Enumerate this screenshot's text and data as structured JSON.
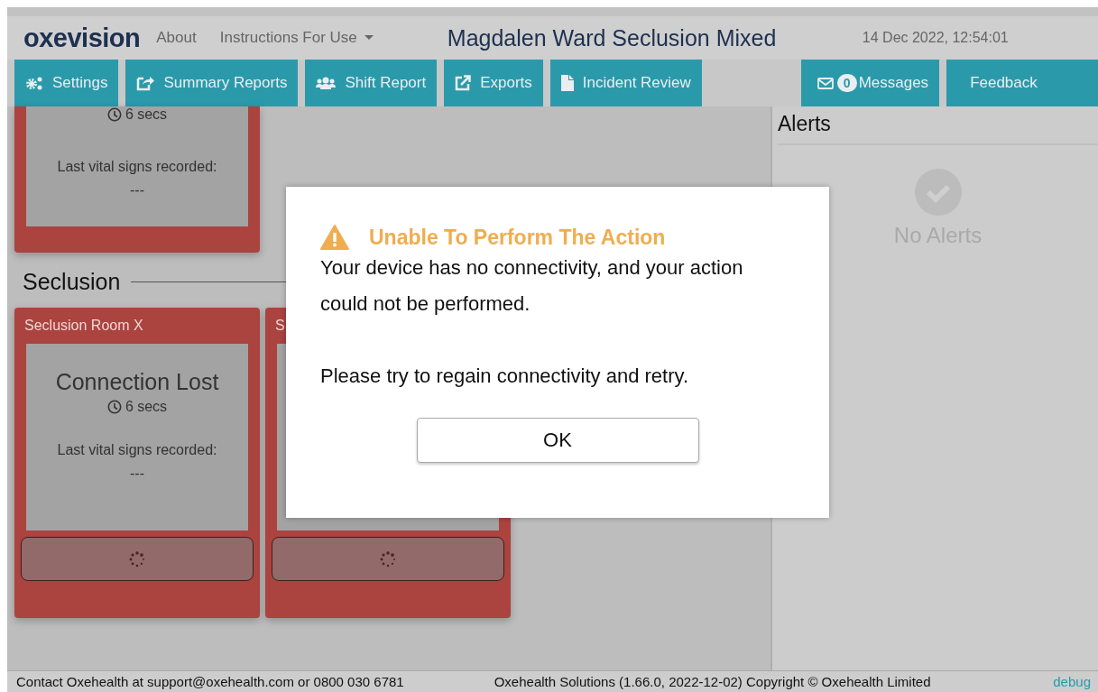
{
  "header": {
    "logo": "oxevision",
    "links": [
      {
        "label": "About",
        "dropdown": false
      },
      {
        "label": "Instructions For Use",
        "dropdown": true
      }
    ],
    "title": "Magdalen Ward Seclusion Mixed",
    "datetime": "14 Dec 2022, 12:54:01"
  },
  "nav": [
    {
      "label": "Settings"
    },
    {
      "label": "Summary Reports"
    },
    {
      "label": "Shift Report"
    },
    {
      "label": "Exports"
    },
    {
      "label": "Incident Review"
    },
    {
      "label": "Messages",
      "badge": "0"
    },
    {
      "label": "Feedback"
    }
  ],
  "top_room": {
    "time": "6 secs",
    "vitals_label": "Last vital signs recorded:",
    "vitals_value": "---"
  },
  "seclusion": {
    "heading": "Seclusion",
    "rooms": [
      {
        "title": "Seclusion Room X",
        "status": "Connection Lost",
        "time": "6 secs",
        "vitals_label": "Last vital signs recorded:",
        "vitals_value": "---"
      },
      {
        "title": "S"
      }
    ]
  },
  "alerts": {
    "title": "Alerts",
    "empty_text": "No Alerts"
  },
  "dialog": {
    "title": "Unable To Perform The Action",
    "message": [
      "Your device has no connectivity, and your action could not be performed.",
      "Please try to regain connectivity and retry."
    ],
    "button": "OK"
  },
  "footer": {
    "contact": "Contact Oxehealth at support@oxehealth.com or 0800 030 6781",
    "copyright": "Oxehealth Solutions (1.66.0, 2022-12-02) Copyright © Oxehealth Limited",
    "debug": "debug"
  }
}
